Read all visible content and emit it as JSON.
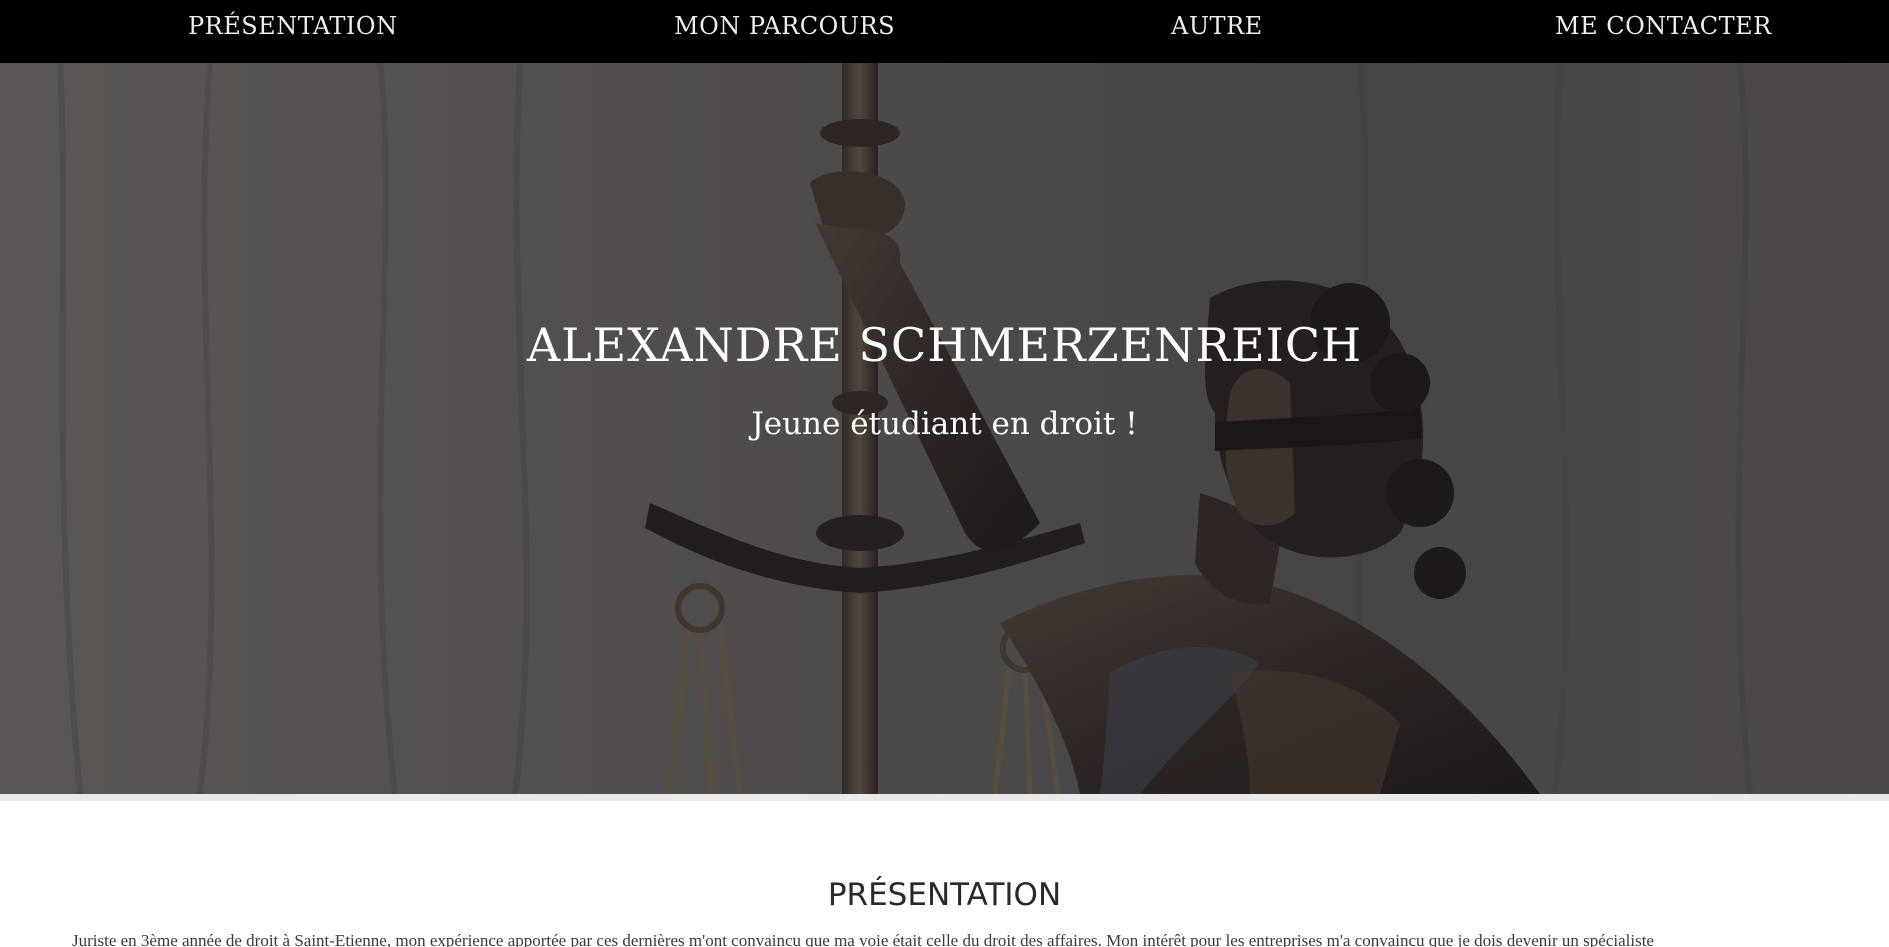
{
  "nav": {
    "items": [
      {
        "label": "PRÉSENTATION"
      },
      {
        "label": "MON PARCOURS"
      },
      {
        "label": "AUTRE"
      },
      {
        "label": "ME CONTACTER"
      }
    ]
  },
  "hero": {
    "title": "ALEXANDRE SCHMERZENREICH",
    "subtitle": "Jeune étudiant en droit !",
    "image_icon": "lady-justice-statue-image"
  },
  "presentation": {
    "title": "PRÉSENTATION",
    "text": "Juriste en 3ème année de droit à Saint-Etienne, mon expérience apportée par ces dernières m'ont convaincu que ma voie était celle du droit des affaires. Mon intérêt pour les entreprises m'a convaincu que je dois devenir un spécialiste"
  },
  "colors": {
    "nav_bg": "#000000",
    "nav_text": "#f2ede6",
    "hero_text": "#ffffff",
    "heading_text": "#2a2a2a"
  }
}
